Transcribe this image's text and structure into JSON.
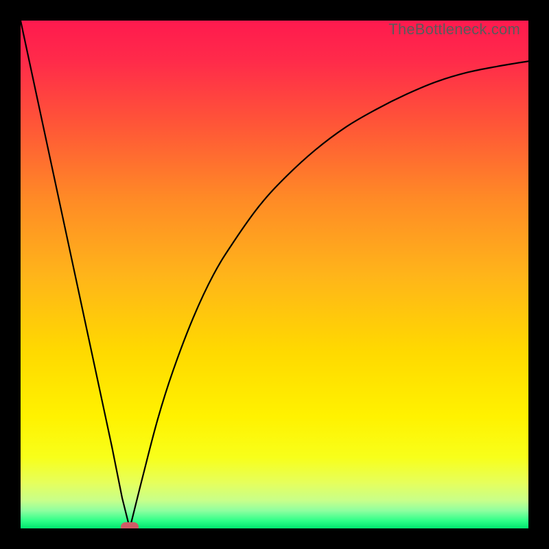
{
  "watermark": "TheBottleneck.com",
  "colors": {
    "frame": "#000000",
    "curve": "#000000",
    "marker": "#cf5b66",
    "gradient_stops": [
      {
        "offset": 0.0,
        "color": "#ff1a4e"
      },
      {
        "offset": 0.08,
        "color": "#ff2b4a"
      },
      {
        "offset": 0.2,
        "color": "#ff5438"
      },
      {
        "offset": 0.35,
        "color": "#ff8a26"
      },
      {
        "offset": 0.5,
        "color": "#ffb41a"
      },
      {
        "offset": 0.65,
        "color": "#ffd900"
      },
      {
        "offset": 0.78,
        "color": "#fff200"
      },
      {
        "offset": 0.86,
        "color": "#f8ff1a"
      },
      {
        "offset": 0.91,
        "color": "#e6ff5c"
      },
      {
        "offset": 0.945,
        "color": "#c8ff8a"
      },
      {
        "offset": 0.965,
        "color": "#8effa0"
      },
      {
        "offset": 0.985,
        "color": "#2eff88"
      },
      {
        "offset": 1.0,
        "color": "#00e56e"
      }
    ]
  },
  "chart_data": {
    "type": "line",
    "title": "",
    "xlabel": "",
    "ylabel": "",
    "xlim": [
      0,
      1
    ],
    "ylim": [
      0,
      1
    ],
    "note": "V-shaped bottleneck curve. Minimum (optimal match) near x≈0.215. Left branch is nearly straight from (0,1) down to the minimum; right branch rises concavely toward ~0.92 at x=1.",
    "series": [
      {
        "name": "left-branch",
        "x": [
          0.0,
          0.03,
          0.06,
          0.09,
          0.12,
          0.15,
          0.18,
          0.2,
          0.215
        ],
        "values": [
          1.0,
          0.86,
          0.72,
          0.58,
          0.44,
          0.3,
          0.16,
          0.06,
          0.0
        ]
      },
      {
        "name": "right-branch",
        "x": [
          0.215,
          0.24,
          0.27,
          0.3,
          0.34,
          0.38,
          0.42,
          0.47,
          0.52,
          0.58,
          0.64,
          0.7,
          0.76,
          0.82,
          0.88,
          0.94,
          1.0
        ],
        "values": [
          0.0,
          0.1,
          0.215,
          0.31,
          0.415,
          0.5,
          0.565,
          0.635,
          0.69,
          0.745,
          0.79,
          0.825,
          0.855,
          0.88,
          0.898,
          0.91,
          0.92
        ]
      }
    ],
    "marker": {
      "x": 0.215,
      "y": 0.0
    }
  }
}
